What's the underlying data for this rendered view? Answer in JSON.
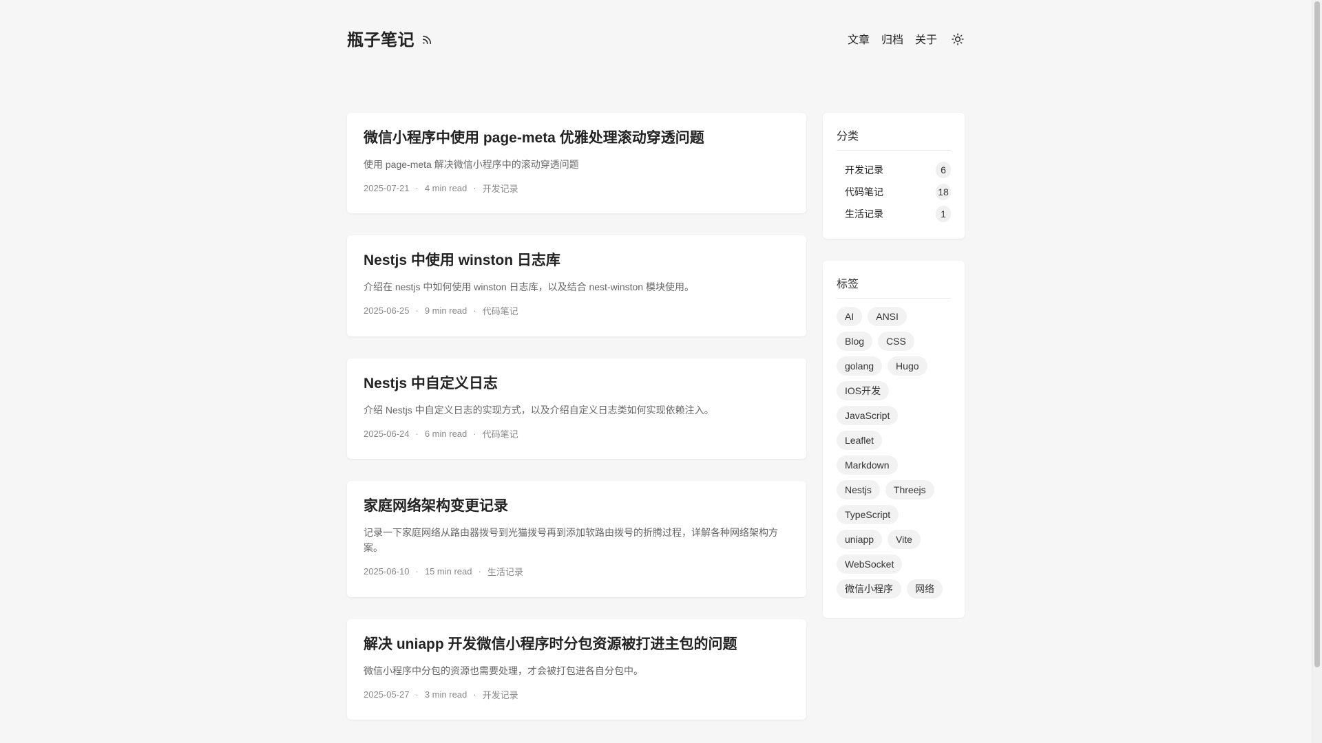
{
  "site": {
    "title": "瓶子笔记"
  },
  "nav": {
    "articles": "文章",
    "archive": "归档",
    "about": "关于"
  },
  "posts": [
    {
      "title": "微信小程序中使用 page-meta 优雅处理滚动穿透问题",
      "desc": "使用 page-meta 解决微信小程序中的滚动穿透问题",
      "date": "2025-07-21",
      "read": "4 min read",
      "category": "开发记录"
    },
    {
      "title": "Nestjs 中使用 winston 日志库",
      "desc": "介绍在 nestjs 中如何使用 winston 日志库，以及结合 nest-winston 模块使用。",
      "date": "2025-06-25",
      "read": "9 min read",
      "category": "代码笔记"
    },
    {
      "title": "Nestjs 中自定义日志",
      "desc": "介绍 Nestjs 中自定义日志的实现方式，以及介绍自定义日志类如何实现依赖注入。",
      "date": "2025-06-24",
      "read": "6 min read",
      "category": "代码笔记"
    },
    {
      "title": "家庭网络架构变更记录",
      "desc": "记录一下家庭网络从路由器拨号到光猫拨号再到添加软路由拨号的折腾过程，详解各种网络架构方案。",
      "date": "2025-06-10",
      "read": "15 min read",
      "category": "生活记录"
    },
    {
      "title": "解决 uniapp 开发微信小程序时分包资源被打进主包的问题",
      "desc": "微信小程序中分包的资源也需要处理，才会被打包进各自分包中。",
      "date": "2025-05-27",
      "read": "3 min read",
      "category": "开发记录"
    }
  ],
  "sidebar": {
    "categories_title": "分类",
    "categories": [
      {
        "name": "开发记录",
        "count": "6"
      },
      {
        "name": "代码笔记",
        "count": "18"
      },
      {
        "name": "生活记录",
        "count": "1"
      }
    ],
    "tags_title": "标签",
    "tags": [
      "AI",
      "ANSI",
      "Blog",
      "CSS",
      "golang",
      "Hugo",
      "IOS开发",
      "JavaScript",
      "Leaflet",
      "Markdown",
      "Nestjs",
      "Threejs",
      "TypeScript",
      "uniapp",
      "Vite",
      "WebSocket",
      "微信小程序",
      "网络"
    ]
  },
  "icons": {
    "rss": "rss-icon",
    "theme": "sun-icon"
  },
  "colors": {
    "background": "#f6f6f6",
    "card": "#ffffff",
    "text": "#222222",
    "muted": "#888888"
  }
}
